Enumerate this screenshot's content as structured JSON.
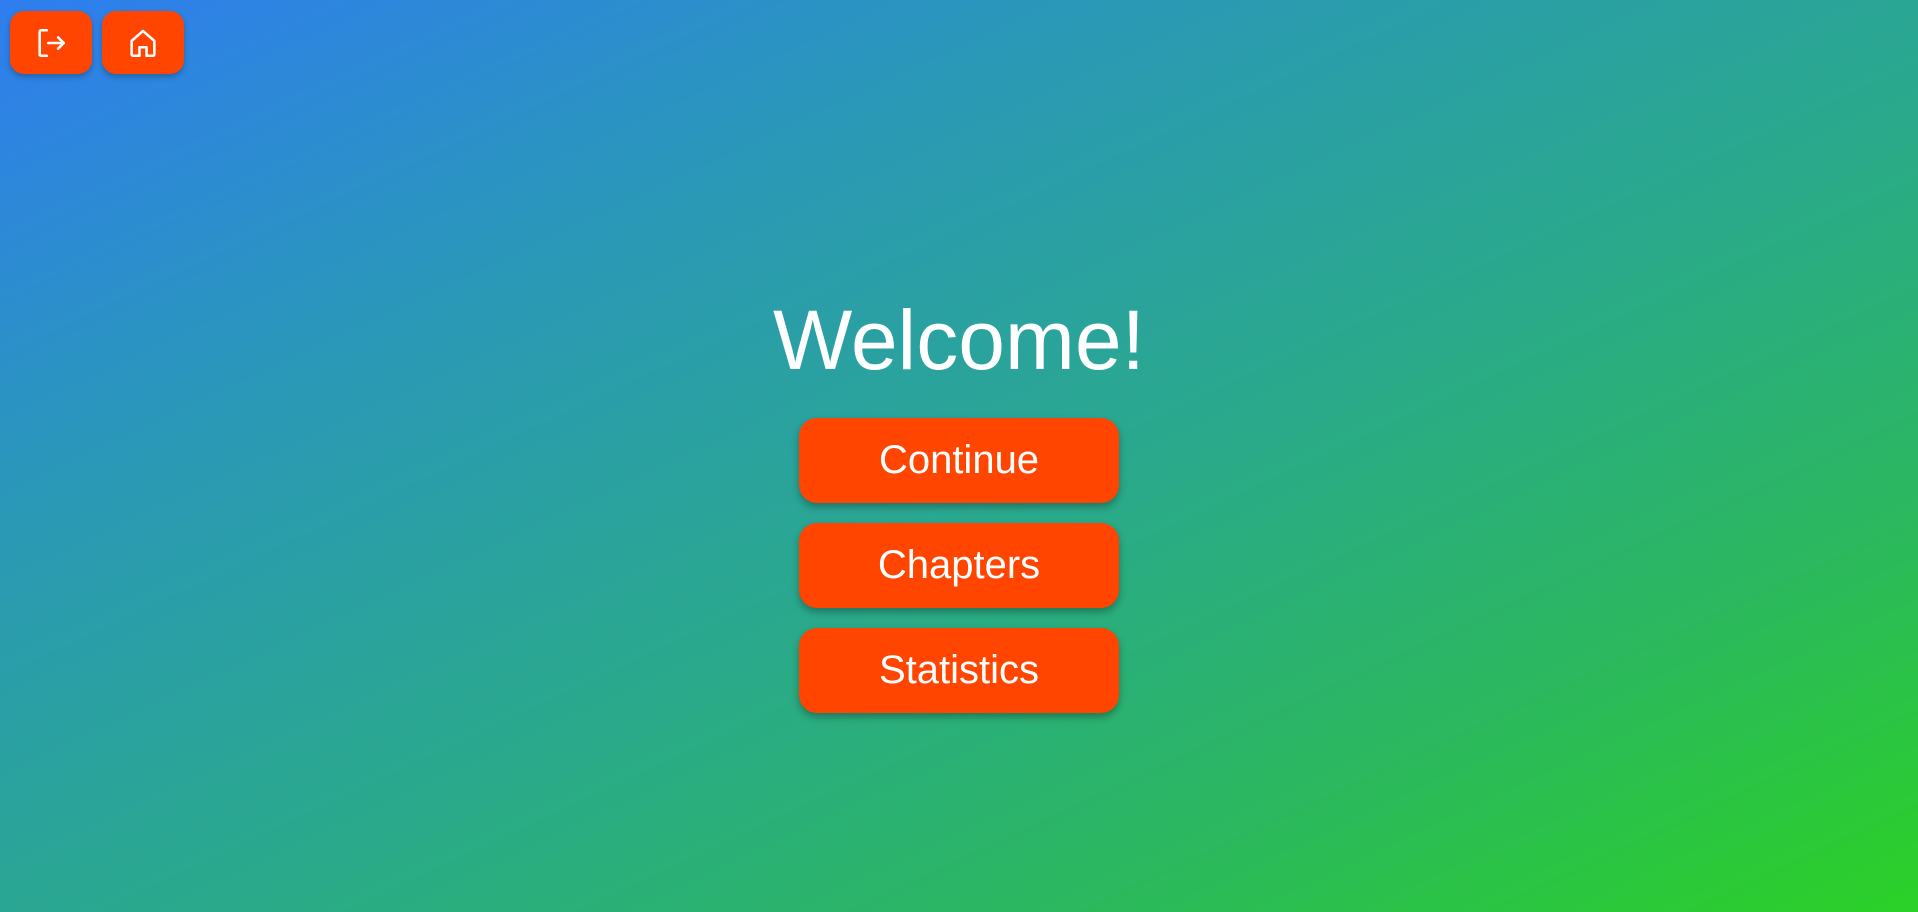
{
  "top_bar": {
    "buttons": [
      {
        "icon": "logout-icon",
        "label": "Logout"
      },
      {
        "icon": "home-icon",
        "label": "Home"
      }
    ]
  },
  "main": {
    "title": "Welcome!",
    "buttons": [
      {
        "label": "Continue"
      },
      {
        "label": "Chapters"
      },
      {
        "label": "Statistics"
      }
    ]
  },
  "colors": {
    "accent": "#ff4500",
    "gradient_start": "#2f7df0",
    "gradient_end": "#2bd126",
    "text": "#ffffff"
  }
}
